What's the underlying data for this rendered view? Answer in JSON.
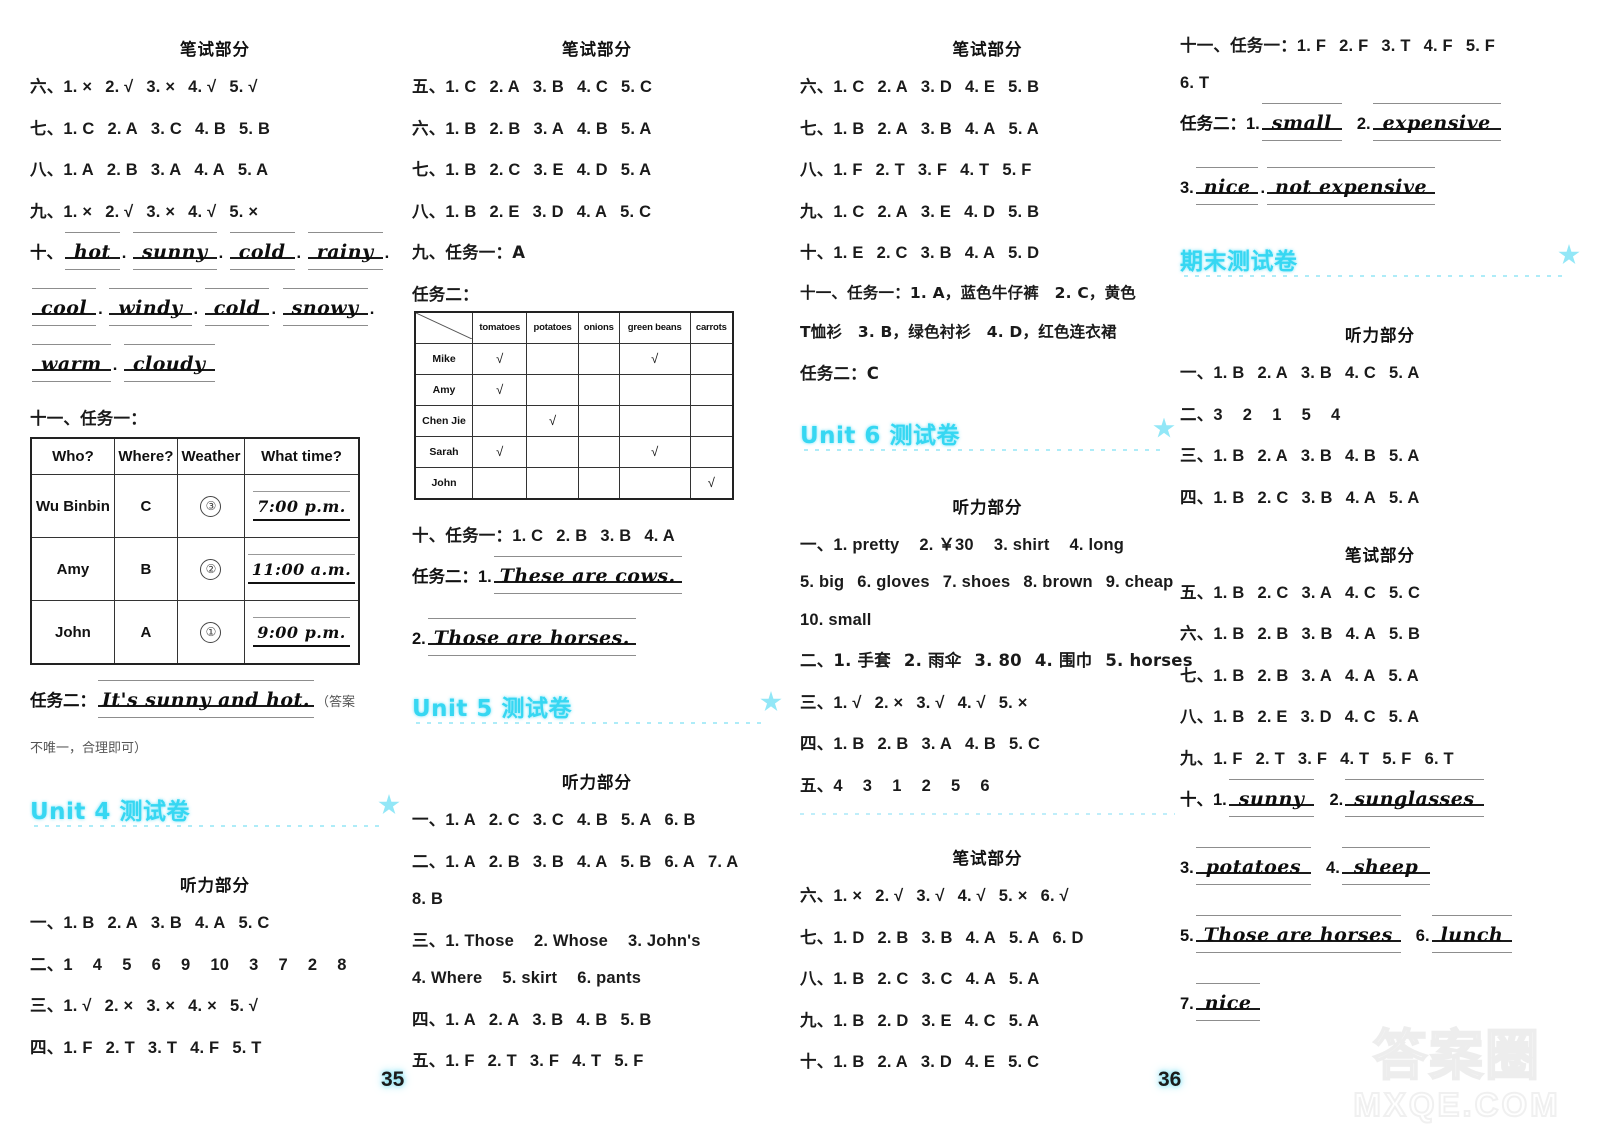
{
  "meta": {
    "page_left": "35",
    "page_right": "36",
    "watermark_cn": "答案圈",
    "watermark_site": "MXQE.COM"
  },
  "labels": {
    "written_part": "笔试部分",
    "listening_part": "听力部分",
    "task_one": "任务一",
    "task_two": "任务二",
    "colon": "：",
    "num9_task": "九、任务",
    "num11_task": "十一、任务"
  },
  "col1": {
    "header": "笔试部分",
    "rows": [
      {
        "num": "六、",
        "items": [
          "1. ×",
          "2. √",
          "3. ×",
          "4. √",
          "5. √"
        ]
      },
      {
        "num": "七、",
        "items": [
          "1. C",
          "2. A",
          "3. C",
          "4. B",
          "5. B"
        ]
      },
      {
        "num": "八、",
        "items": [
          "1. A",
          "2. B",
          "3. A",
          "4. A",
          "5. A"
        ]
      },
      {
        "num": "九、",
        "items": [
          "1. ×",
          "2. √",
          "3. ×",
          "4. √",
          "5. ×"
        ]
      }
    ],
    "q10_label": "十、",
    "q10_words_line1": [
      "hot",
      "sunny",
      "cold",
      "rainy"
    ],
    "q10_words_line2": [
      "cool",
      "windy",
      "cold",
      "snowy"
    ],
    "q10_words_line3": [
      "warm",
      "cloudy"
    ],
    "q11_label": "十一、任务一：",
    "weather_table": {
      "headers": [
        "Who?",
        "Where?",
        "Weather",
        "What time?"
      ],
      "rows": [
        {
          "who": "Wu Binbin",
          "where": "C",
          "weather": "③",
          "time": "7:00 p.m."
        },
        {
          "who": "Amy",
          "where": "B",
          "weather": "②",
          "time": "11:00 a.m."
        },
        {
          "who": "John",
          "where": "A",
          "weather": "①",
          "time": "9:00 p.m."
        }
      ]
    },
    "task2_label": "任务二：",
    "task2_answer": "It's sunny and hot.",
    "task2_note_open": "（答案",
    "task2_note_close": "不唯一，合理即可）",
    "unit4": {
      "title": "Unit 4 测试卷",
      "listening_header": "听力部分",
      "rows": [
        {
          "num": "一、",
          "items": [
            "1. B",
            "2. A",
            "3. B",
            "4. A",
            "5. C"
          ]
        },
        {
          "num": "二、",
          "items": [
            "1",
            "4",
            "5",
            "6",
            "9",
            "10",
            "3",
            "7",
            "2",
            "8"
          ]
        },
        {
          "num": "三、",
          "items": [
            "1. √",
            "2. ×",
            "3. ×",
            "4. ×",
            "5. √"
          ]
        },
        {
          "num": "四、",
          "items": [
            "1. F",
            "2. T",
            "3. T",
            "4. F",
            "5. T"
          ]
        }
      ]
    }
  },
  "col2": {
    "header": "笔试部分",
    "rows": [
      {
        "num": "五、",
        "items": [
          "1. C",
          "2. A",
          "3. B",
          "4. C",
          "5. C"
        ]
      },
      {
        "num": "六、",
        "items": [
          "1. B",
          "2. B",
          "3. A",
          "4. B",
          "5. A"
        ]
      },
      {
        "num": "七、",
        "items": [
          "1. B",
          "2. C",
          "3. E",
          "4. D",
          "5. A"
        ]
      },
      {
        "num": "八、",
        "items": [
          "1. B",
          "2. E",
          "3. D",
          "4. A",
          "5. C"
        ]
      }
    ],
    "q9_label": "九、任务一：A",
    "task2_label": "任务二：",
    "food_table": {
      "columns": [
        "tomatoes",
        "potatoes",
        "onions",
        "green beans",
        "carrots"
      ],
      "rows": [
        {
          "name": "Mike",
          "checks": [
            true,
            false,
            false,
            true,
            false
          ]
        },
        {
          "name": "Amy",
          "checks": [
            true,
            false,
            false,
            false,
            false
          ]
        },
        {
          "name": "Chen Jie",
          "checks": [
            false,
            true,
            false,
            false,
            false
          ]
        },
        {
          "name": "Sarah",
          "checks": [
            true,
            false,
            false,
            true,
            false
          ]
        },
        {
          "name": "John",
          "checks": [
            false,
            false,
            false,
            false,
            true
          ]
        }
      ],
      "check_mark": "√"
    },
    "q10_label": "十、任务一：",
    "q10_items": [
      "1. C",
      "2. B",
      "3. B",
      "4. A"
    ],
    "q10_task2_label": "任务二：",
    "q10_task2_n1": "1.",
    "q10_task2_a1": "These are cows.",
    "q10_task2_n2": "2.",
    "q10_task2_a2": "Those are horses.",
    "unit5": {
      "title": "Unit 5 测试卷",
      "listening_header": "听力部分",
      "rows": [
        {
          "num": "一、",
          "items": [
            "1. A",
            "2. C",
            "3. C",
            "4. B",
            "5. A",
            "6. B"
          ]
        },
        {
          "num": "二、",
          "items": [
            "1. A",
            "2. B",
            "3. B",
            "4. A",
            "5. B",
            "6. A",
            "7. A"
          ]
        },
        {
          "num": "",
          "items": [
            "8. B"
          ]
        },
        {
          "num": "三、",
          "items": [
            "1. Those",
            "2. Whose",
            "3. John's"
          ]
        },
        {
          "num": "",
          "items": [
            "4. Where",
            "5. skirt",
            "6. pants"
          ]
        },
        {
          "num": "四、",
          "items": [
            "1. A",
            "2. A",
            "3. B",
            "4. B",
            "5. B"
          ]
        },
        {
          "num": "五、",
          "items": [
            "1. F",
            "2. T",
            "3. F",
            "4. T",
            "5. F"
          ]
        }
      ]
    }
  },
  "col3": {
    "header": "笔试部分",
    "rows": [
      {
        "num": "六、",
        "items": [
          "1. C",
          "2. A",
          "3. D",
          "4. E",
          "5. B"
        ]
      },
      {
        "num": "七、",
        "items": [
          "1. B",
          "2. A",
          "3. B",
          "4. A",
          "5. A"
        ]
      },
      {
        "num": "八、",
        "items": [
          "1. F",
          "2. T",
          "3. F",
          "4. T",
          "5. F"
        ]
      },
      {
        "num": "九、",
        "items": [
          "1. C",
          "2. A",
          "3. E",
          "4. D",
          "5. B"
        ]
      },
      {
        "num": "十、",
        "items": [
          "1. E",
          "2. C",
          "3. B",
          "4. A",
          "5. D"
        ]
      }
    ],
    "q11_line1": "十一、任务一：1. A，蓝色牛仔裤　2. C，黄色",
    "q11_line2": "T恤衫　3. B，绿色衬衫　4. D，红色连衣裙",
    "q11_task2": "任务二：C",
    "unit6": {
      "title": "Unit 6 测试卷",
      "listening_header": "听力部分",
      "rows": [
        {
          "num": "一、",
          "items": [
            "1. pretty",
            "2. ￥30",
            "3. shirt",
            "4. long"
          ]
        },
        {
          "num": "",
          "items": [
            "5. big",
            "6. gloves",
            "7. shoes",
            "8. brown",
            "9. cheap"
          ]
        },
        {
          "num": "",
          "items": [
            "10. small"
          ]
        },
        {
          "num": "二、",
          "items": [
            "1. 手套",
            "2. 雨伞",
            "3. 80",
            "4. 围巾",
            "5. horses"
          ]
        },
        {
          "num": "三、",
          "items": [
            "1. √",
            "2. ×",
            "3. √",
            "4. √",
            "5. ×"
          ]
        },
        {
          "num": "四、",
          "items": [
            "1. B",
            "2. B",
            "3. A",
            "4. B",
            "5. C"
          ]
        },
        {
          "num": "五、",
          "items": [
            "4",
            "3",
            "1",
            "2",
            "5",
            "6"
          ]
        }
      ],
      "written_header": "笔试部分",
      "written_rows": [
        {
          "num": "六、",
          "items": [
            "1. ×",
            "2. √",
            "3. √",
            "4. √",
            "5. ×",
            "6. √"
          ]
        },
        {
          "num": "七、",
          "items": [
            "1. D",
            "2. B",
            "3. B",
            "4. A",
            "5. A",
            "6. D"
          ]
        },
        {
          "num": "八、",
          "items": [
            "1. B",
            "2. C",
            "3. C",
            "4. A",
            "5. A"
          ]
        },
        {
          "num": "九、",
          "items": [
            "1. B",
            "2. D",
            "3. E",
            "4. C",
            "5. A"
          ]
        },
        {
          "num": "十、",
          "items": [
            "1. B",
            "2. A",
            "3. D",
            "4. E",
            "5. C"
          ]
        }
      ]
    }
  },
  "col4": {
    "q11_label": "十一、任务一：",
    "q11_items": [
      "1. F",
      "2. F",
      "3. T",
      "4. F",
      "5. F"
    ],
    "q11_items_cont": [
      "6. T"
    ],
    "task2_label": "任务二：",
    "task2_n1": "1.",
    "task2_a1": "small",
    "task2_n2": "2.",
    "task2_a2": "expensive",
    "task2_n3": "3.",
    "task2_a3": "nice",
    "task2_a3b": "not expensive",
    "final": {
      "title": "期末测试卷",
      "listening_header": "听力部分",
      "rows": [
        {
          "num": "一、",
          "items": [
            "1. B",
            "2. A",
            "3. B",
            "4. C",
            "5. A"
          ]
        },
        {
          "num": "二、",
          "items": [
            "3",
            "2",
            "1",
            "5",
            "4"
          ]
        },
        {
          "num": "三、",
          "items": [
            "1. B",
            "2. A",
            "3. B",
            "4. B",
            "5. A"
          ]
        },
        {
          "num": "四、",
          "items": [
            "1. B",
            "2. C",
            "3. B",
            "4. A",
            "5. A"
          ]
        }
      ],
      "written_header": "笔试部分",
      "written_rows": [
        {
          "num": "五、",
          "items": [
            "1. B",
            "2. C",
            "3. A",
            "4. C",
            "5. C"
          ]
        },
        {
          "num": "六、",
          "items": [
            "1. B",
            "2. B",
            "3. B",
            "4. A",
            "5. B"
          ]
        },
        {
          "num": "七、",
          "items": [
            "1. B",
            "2. B",
            "3. A",
            "4. A",
            "5. A"
          ]
        },
        {
          "num": "八、",
          "items": [
            "1. B",
            "2. E",
            "3. D",
            "4. C",
            "5. A"
          ]
        },
        {
          "num": "九、",
          "items": [
            "1. F",
            "2. T",
            "3. F",
            "4. T",
            "5. F",
            "6. T"
          ]
        }
      ],
      "q10_label": "十、",
      "q10": [
        {
          "n": "1.",
          "a": "sunny"
        },
        {
          "n": "2.",
          "a": "sunglasses"
        },
        {
          "n": "3.",
          "a": "potatoes"
        },
        {
          "n": "4.",
          "a": "sheep"
        },
        {
          "n": "5.",
          "a": "Those are horses"
        },
        {
          "n": "6.",
          "a": "lunch"
        },
        {
          "n": "7.",
          "a": "nice"
        }
      ]
    }
  }
}
